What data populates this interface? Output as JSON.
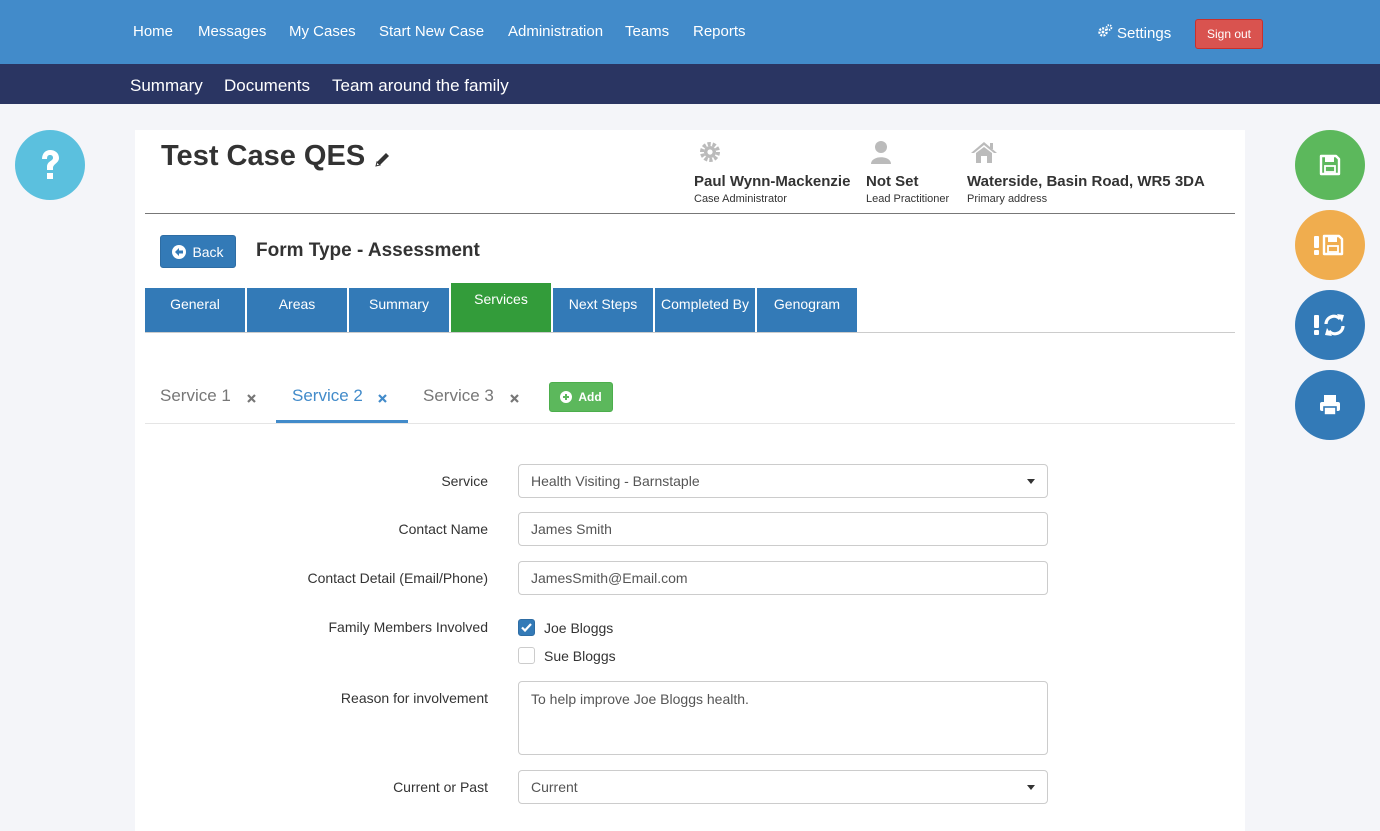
{
  "topnav": {
    "items": [
      {
        "label": "Home"
      },
      {
        "label": "Messages"
      },
      {
        "label": "My Cases"
      },
      {
        "label": "Start New Case"
      },
      {
        "label": "Administration"
      },
      {
        "label": "Teams"
      },
      {
        "label": "Reports"
      }
    ],
    "settings_label": "Settings",
    "signout_label": "Sign out"
  },
  "subnav": {
    "items": [
      {
        "label": "Summary"
      },
      {
        "label": "Documents"
      },
      {
        "label": "Team around the family"
      }
    ]
  },
  "case": {
    "title": "Test Case QES",
    "administrator": {
      "name": "Paul Wynn-Mackenzie",
      "role": "Case Administrator"
    },
    "lead": {
      "name": "Not Set",
      "role": "Lead Practitioner"
    },
    "address": {
      "name": "Waterside, Basin Road, WR5 3DA",
      "role": "Primary address"
    }
  },
  "form": {
    "back_label": "Back",
    "title": "Form Type - Assessment"
  },
  "tabs": [
    {
      "label": "General"
    },
    {
      "label": "Areas"
    },
    {
      "label": "Summary"
    },
    {
      "label": "Services"
    },
    {
      "label": "Next Steps"
    },
    {
      "label": "Completed By"
    },
    {
      "label": "Genogram"
    }
  ],
  "service_tabs": [
    {
      "label": "Service 1"
    },
    {
      "label": "Service 2"
    },
    {
      "label": "Service 3"
    }
  ],
  "add_label": "Add",
  "fields": {
    "service": {
      "label": "Service",
      "value": "Health Visiting - Barnstaple"
    },
    "contact_name": {
      "label": "Contact Name",
      "value": "James Smith"
    },
    "contact_detail": {
      "label": "Contact Detail (Email/Phone)",
      "value": "JamesSmith@Email.com"
    },
    "family_members": {
      "label": "Family Members Involved",
      "options": [
        {
          "label": "Joe Bloggs",
          "checked": true
        },
        {
          "label": "Sue Bloggs",
          "checked": false
        }
      ]
    },
    "reason": {
      "label": "Reason for involvement",
      "value": "To help improve Joe Bloggs health."
    },
    "current_or_past": {
      "label": "Current or Past",
      "value": "Current"
    }
  }
}
